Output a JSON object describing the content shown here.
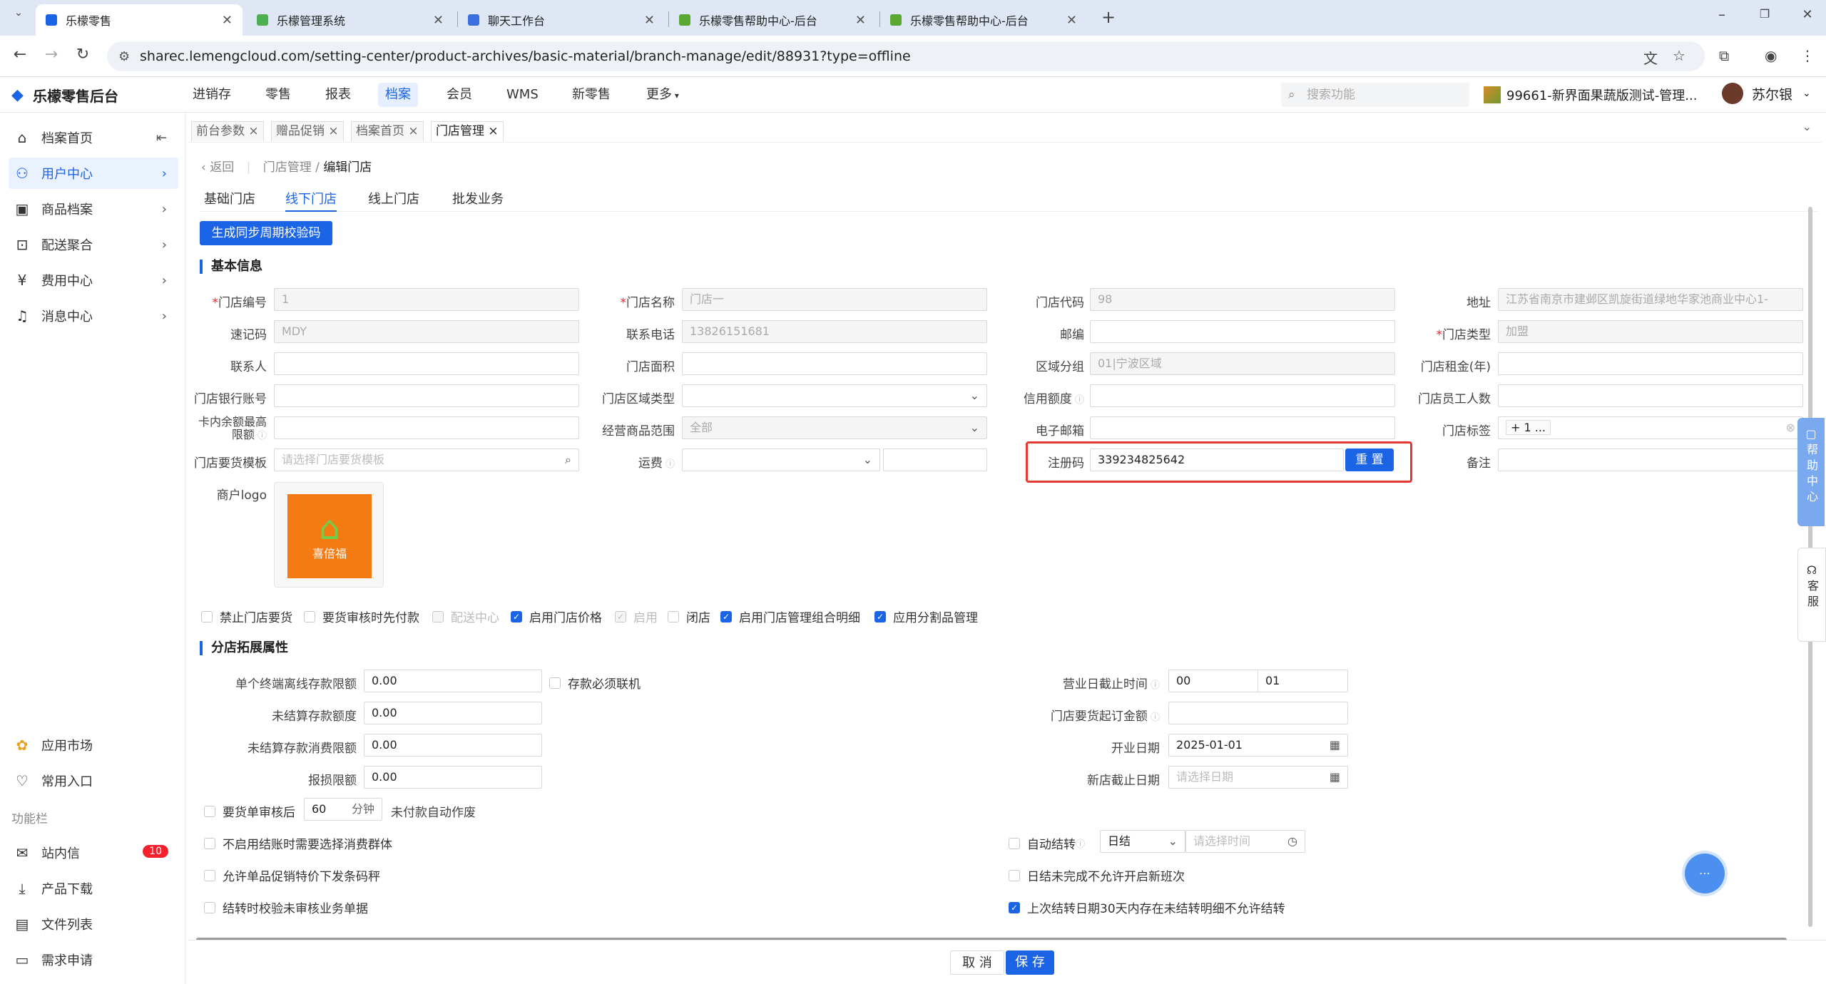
{
  "browser": {
    "tabs": [
      {
        "title": "乐檬零售",
        "color": "#1c64e6"
      },
      {
        "title": "乐檬管理系统",
        "color": "#4caf50"
      },
      {
        "title": "聊天工作台",
        "color": "#3a6fe0"
      },
      {
        "title": "乐檬零售帮助中心-后台",
        "color": "#5aa832"
      },
      {
        "title": "乐檬零售帮助中心-后台",
        "color": "#5aa832"
      }
    ],
    "url": "sharec.lemengcloud.com/setting-center/product-archives/basic-material/branch-manage/edit/88931?type=offline"
  },
  "header": {
    "brand": "乐檬零售后台",
    "nav": [
      "进销存",
      "零售",
      "报表",
      "档案",
      "会员",
      "WMS",
      "新零售",
      "更多"
    ],
    "active_nav": "档案",
    "search_placeholder": "搜索功能",
    "store": "99661-新界面果蔬版测试-管理...",
    "user": "苏尔银"
  },
  "sidebar": {
    "items": [
      {
        "label": "档案首页",
        "icon": "home-icon"
      },
      {
        "label": "用户中心",
        "icon": "user-icon"
      },
      {
        "label": "商品档案",
        "icon": "box-icon"
      },
      {
        "label": "配送聚合",
        "icon": "delivery-icon"
      },
      {
        "label": "费用中心",
        "icon": "yen-icon"
      },
      {
        "label": "消息中心",
        "icon": "bell-icon"
      }
    ],
    "bottom": [
      {
        "label": "应用市场",
        "icon": "apps-icon"
      },
      {
        "label": "常用入口",
        "icon": "heart-icon"
      }
    ],
    "section_label": "功能栏",
    "tools": [
      {
        "label": "站内信",
        "icon": "mail-icon",
        "badge": "10"
      },
      {
        "label": "产品下载",
        "icon": "download-icon"
      },
      {
        "label": "文件列表",
        "icon": "file-list-icon"
      },
      {
        "label": "需求申请",
        "icon": "request-icon"
      }
    ]
  },
  "page_tabs": [
    "前台参数",
    "赠品促销",
    "档案首页",
    "门店管理"
  ],
  "breadcrumb": {
    "back": "返回",
    "parent": "门店管理",
    "current": "编辑门店"
  },
  "form_tabs": [
    "基础门店",
    "线下门店",
    "线上门店",
    "批发业务"
  ],
  "active_form_tab": "线下门店",
  "generate_button": "生成同步周期校验码",
  "basic_section": "基本信息",
  "fields": {
    "store_no": {
      "label": "门店编号",
      "value": "1"
    },
    "store_name": {
      "label": "门店名称",
      "value": "门店一"
    },
    "store_code": {
      "label": "门店代码",
      "value": "98"
    },
    "address": {
      "label": "地址",
      "value": "江苏省南京市建邺区凯旋街道绿地华家池商业中心1-"
    },
    "quick_code": {
      "label": "速记码",
      "value": "MDY"
    },
    "phone": {
      "label": "联系电话",
      "value": "13826151681"
    },
    "postcode": {
      "label": "邮编",
      "value": ""
    },
    "store_type": {
      "label": "门店类型",
      "value": "加盟"
    },
    "contact": {
      "label": "联系人",
      "value": ""
    },
    "area": {
      "label": "门店面积",
      "value": ""
    },
    "region_group": {
      "label": "区域分组",
      "value": "01|宁波区域"
    },
    "rent": {
      "label": "门店租金(年)",
      "value": ""
    },
    "bank_account": {
      "label": "门店银行账号",
      "value": ""
    },
    "region_type": {
      "label": "门店区域类型",
      "value": ""
    },
    "credit": {
      "label": "信用额度",
      "value": ""
    },
    "staff_count": {
      "label": "门店员工人数",
      "value": ""
    },
    "card_limit": {
      "label": "卡内余额最高限额",
      "value": ""
    },
    "scope": {
      "label": "经营商品范围",
      "value": "全部"
    },
    "email": {
      "label": "电子邮箱",
      "value": ""
    },
    "tags": {
      "label": "门店标签",
      "value": "+ 1 ..."
    },
    "template": {
      "label": "门店要货模板",
      "placeholder": "请选择门店要货模板"
    },
    "freight": {
      "label": "运费",
      "value": ""
    },
    "reg_code": {
      "label": "注册码",
      "value": "339234825642",
      "button": "重 置"
    },
    "remark": {
      "label": "备注",
      "value": ""
    },
    "logo": {
      "label": "商户logo",
      "logo_text": "喜倍福"
    }
  },
  "checkboxes": [
    {
      "label": "禁止门店要货",
      "checked": false,
      "disabled": false
    },
    {
      "label": "要货审核时先付款",
      "checked": false,
      "disabled": false
    },
    {
      "label": "配送中心",
      "checked": false,
      "disabled": true
    },
    {
      "label": "启用门店价格",
      "checked": true,
      "disabled": false
    },
    {
      "label": "启用",
      "checked": true,
      "disabled": true
    },
    {
      "label": "闭店",
      "checked": false,
      "disabled": false
    },
    {
      "label": "启用门店管理组合明细",
      "checked": true,
      "disabled": false
    },
    {
      "label": "应用分割品管理",
      "checked": true,
      "disabled": false
    }
  ],
  "ext_section": "分店拓展属性",
  "ext": {
    "offline_limit": {
      "label": "单个终端离线存款限额",
      "value": "0.00"
    },
    "must_online": {
      "label": "存款必须联机"
    },
    "unsettled_limit": {
      "label": "未结算存款额度",
      "value": "0.00"
    },
    "unsettled_consume": {
      "label": "未结算存款消费限额",
      "value": "0.00"
    },
    "loss_limit": {
      "label": "报损限额",
      "value": "0.00"
    },
    "biz_cutoff": {
      "label": "营业日截止时间",
      "hour": "00",
      "minute": "01"
    },
    "min_order": {
      "label": "门店要货起订金额",
      "value": ""
    },
    "open_date": {
      "label": "开业日期",
      "value": "2025-01-01"
    },
    "new_store_end": {
      "label": "新店截止日期",
      "placeholder": "请选择日期"
    },
    "review_after": {
      "label": "要货单审核后",
      "value": "60",
      "unit": "分钟",
      "suffix": "未付款自动作废"
    },
    "opt1": {
      "label": "不启用结账时需要选择消费群体"
    },
    "opt2": {
      "label": "允许单品促销特价下发条码秤"
    },
    "opt3": {
      "label": "结转时校验未审核业务单据"
    },
    "auto_carry": {
      "label": "自动结转",
      "select": "日结",
      "time_placeholder": "请选择时间"
    },
    "opt4": {
      "label": "日结未完成不允许开启新班次"
    },
    "opt5": {
      "label": "上次结转日期30天内存在未结转明细不允许结转",
      "checked": true
    }
  },
  "footer": {
    "cancel": "取 消",
    "save": "保 存"
  },
  "help": {
    "help_label": "帮助中心",
    "service_label": "客服"
  }
}
